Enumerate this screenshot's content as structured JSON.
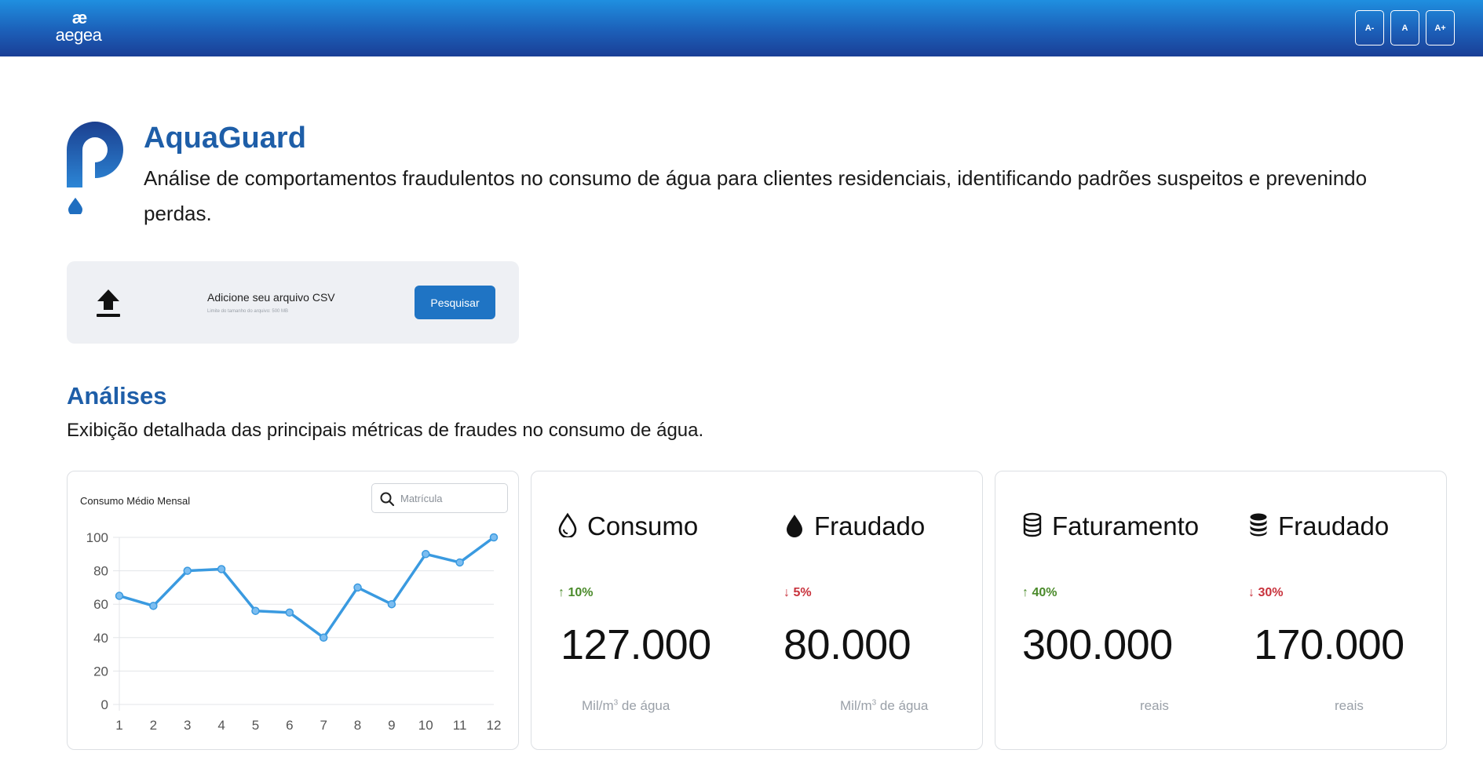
{
  "header": {
    "logo_mark": "æ",
    "logo_text": "aegea",
    "font_buttons": [
      "A-",
      "A",
      "A+"
    ]
  },
  "hero": {
    "title": "AquaGuard",
    "description": "Análise de comportamentos fraudulentos no consumo de água para clientes residenciais, identificando padrões suspeitos e prevenindo perdas."
  },
  "upload": {
    "label": "Adicione seu arquivo CSV",
    "hint": "Limite do tamanho do arquivo: 500 MB",
    "button": "Pesquisar"
  },
  "analyses": {
    "title": "Análises",
    "description": "Exibição detalhada das principais métricas de fraudes no consumo de água."
  },
  "chart_card": {
    "title": "Consumo Médio Mensal",
    "search_placeholder": "Matrícula"
  },
  "chart_data": {
    "type": "line",
    "title": "Consumo Médio Mensal",
    "x": [
      1,
      2,
      3,
      4,
      5,
      6,
      7,
      8,
      9,
      10,
      11,
      12
    ],
    "values": [
      65,
      59,
      80,
      81,
      56,
      55,
      40,
      70,
      60,
      90,
      85,
      100
    ],
    "ylim": [
      0,
      100
    ],
    "yticks": [
      0,
      20,
      40,
      60,
      80,
      100
    ],
    "grid": true,
    "color": "#3a9ae0"
  },
  "metrics": {
    "consumo": {
      "label": "Consumo",
      "icon": "water-drop-outline-icon",
      "change": "↑ 10%",
      "value": "127.000",
      "unit_main": "Mil/m",
      "unit_sup": "3",
      "unit_tail": " de água"
    },
    "fraudado_agua": {
      "label": "Fraudado",
      "icon": "water-drop-filled-icon",
      "change": "↓ 5%",
      "value": "80.000",
      "unit_main": "Mil/m",
      "unit_sup": "3",
      "unit_tail": " de água"
    },
    "faturamento": {
      "label": "Faturamento",
      "icon": "database-outline-icon",
      "change": "↑ 40%",
      "value": "300.000",
      "unit": "reais"
    },
    "fraudado_reais": {
      "label": "Fraudado",
      "icon": "database-filled-icon",
      "change": "↓ 30%",
      "value": "170.000",
      "unit": "reais"
    }
  },
  "colors": {
    "brand_blue": "#1e5ea8",
    "button_blue": "#1f74c4",
    "positive": "#4a8a2a",
    "negative": "#c8323c"
  }
}
